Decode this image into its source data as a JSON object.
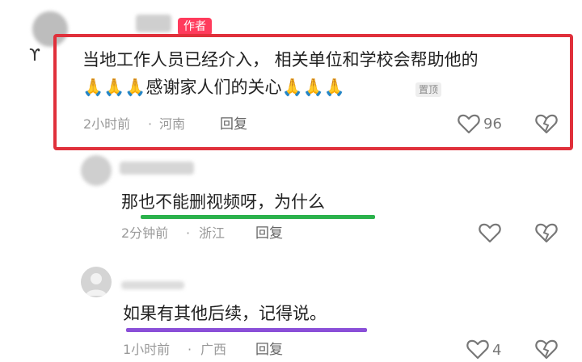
{
  "comments": [
    {
      "author_badge": "作者",
      "text_line1": "当地工作人员已经介入， 相关单位和学校会帮助他的",
      "text_line2_prefix": "🙏🙏🙏",
      "text_line2_main": "感谢家人们的关心",
      "text_line2_suffix": "🙏🙏🙏",
      "pin_label": "置顶",
      "time": "2小时前",
      "location": "河南",
      "reply_label": "回复",
      "like_count": "96"
    },
    {
      "text": "那也不能删视频呀，为什么",
      "time": "2分钟前",
      "location": "浙江",
      "reply_label": "回复",
      "like_count": ""
    },
    {
      "text": "如果有其他后续，记得说。",
      "time": "1小时前",
      "location": "广西",
      "reply_label": "回复",
      "like_count": "4"
    }
  ],
  "colors": {
    "highlight_box": "#e0303b",
    "author_badge": "#ff3b5c",
    "underline_green": "#2bb24c",
    "underline_purple": "#8a4fd8"
  },
  "icons": [
    "avatar",
    "heart-icon",
    "dislike-icon"
  ]
}
